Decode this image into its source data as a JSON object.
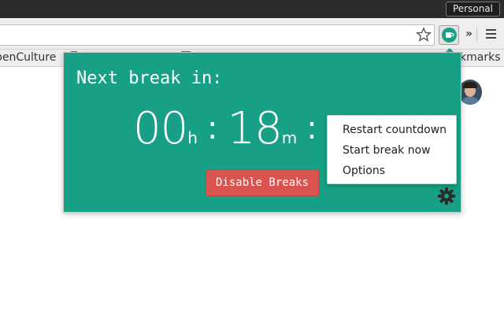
{
  "window": {
    "profile_label": "Personal"
  },
  "bookmarks_bar": {
    "left_item": "penCulture",
    "right_item": "kmarks"
  },
  "popup": {
    "heading": "Next break in:",
    "hours": "00",
    "hours_unit": "h",
    "minutes": "18",
    "minutes_unit": "m",
    "separator": ":",
    "disable_button": "Disable Breaks",
    "accent_color": "#17a085",
    "button_color": "#d9534f"
  },
  "context_menu": {
    "items": [
      {
        "label": "Restart countdown"
      },
      {
        "label": "Start break now"
      },
      {
        "label": "Options"
      }
    ]
  }
}
